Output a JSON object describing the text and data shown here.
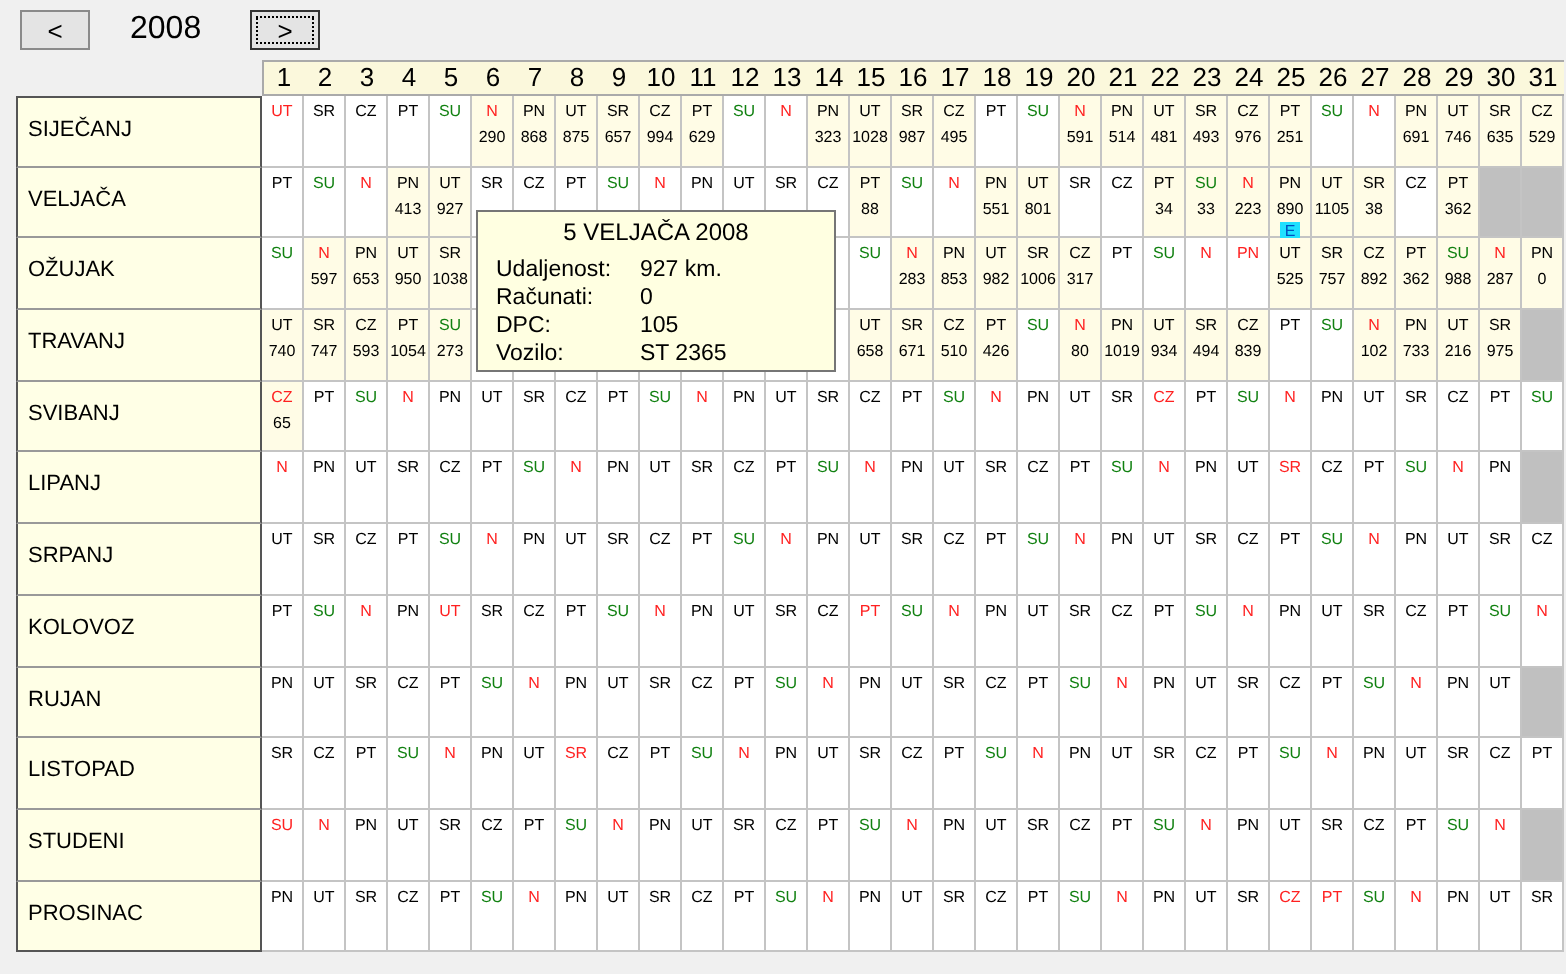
{
  "toolbar": {
    "prev_button": {
      "label": "<",
      "focused": false
    },
    "year": "2008",
    "next_button": {
      "label": ">",
      "focused": true
    }
  },
  "day_headers": [
    "1",
    "2",
    "3",
    "4",
    "5",
    "6",
    "7",
    "8",
    "9",
    "10",
    "11",
    "12",
    "13",
    "14",
    "15",
    "16",
    "17",
    "18",
    "19",
    "20",
    "21",
    "22",
    "23",
    "24",
    "25",
    "26",
    "27",
    "28",
    "29",
    "30",
    "31"
  ],
  "months": [
    {
      "name": "SIJEČANJ",
      "days": [
        {
          "day": "UT",
          "color": "#ff2020"
        },
        {
          "day": "SR"
        },
        {
          "day": "CZ"
        },
        {
          "day": "PT"
        },
        {
          "day": "SU",
          "color": "#108010"
        },
        {
          "day": "N",
          "color": "#ff2020",
          "km": "290"
        },
        {
          "day": "PN",
          "km": "868"
        },
        {
          "day": "UT",
          "km": "875"
        },
        {
          "day": "SR",
          "km": "657"
        },
        {
          "day": "CZ",
          "km": "994"
        },
        {
          "day": "PT",
          "km": "629"
        },
        {
          "day": "SU",
          "color": "#108010"
        },
        {
          "day": "N",
          "color": "#ff2020"
        },
        {
          "day": "PN",
          "km": "323"
        },
        {
          "day": "UT",
          "km": "1028"
        },
        {
          "day": "SR",
          "km": "987"
        },
        {
          "day": "CZ",
          "km": "495"
        },
        {
          "day": "PT"
        },
        {
          "day": "SU",
          "color": "#108010"
        },
        {
          "day": "N",
          "color": "#ff2020",
          "km": "591"
        },
        {
          "day": "PN",
          "km": "514"
        },
        {
          "day": "UT",
          "km": "481"
        },
        {
          "day": "SR",
          "km": "493"
        },
        {
          "day": "CZ",
          "km": "976"
        },
        {
          "day": "PT",
          "km": "251"
        },
        {
          "day": "SU",
          "color": "#108010"
        },
        {
          "day": "N",
          "color": "#ff2020"
        },
        {
          "day": "PN",
          "km": "691"
        },
        {
          "day": "UT",
          "km": "746"
        },
        {
          "day": "SR",
          "km": "635"
        },
        {
          "day": "CZ",
          "km": "529"
        }
      ]
    },
    {
      "name": "VELJAČA",
      "days": [
        {
          "day": "PT"
        },
        {
          "day": "SU",
          "color": "#108010"
        },
        {
          "day": "N",
          "color": "#ff2020"
        },
        {
          "day": "PN",
          "km": "413"
        },
        {
          "day": "UT",
          "km": "927"
        },
        {
          "day": "SR"
        },
        {
          "day": "CZ"
        },
        {
          "day": "PT"
        },
        {
          "day": "SU",
          "color": "#108010"
        },
        {
          "day": "N",
          "color": "#ff2020"
        },
        {
          "day": "PN"
        },
        {
          "day": "UT"
        },
        {
          "day": "SR"
        },
        {
          "day": "CZ"
        },
        {
          "day": "PT",
          "km": "88"
        },
        {
          "day": "SU",
          "color": "#108010"
        },
        {
          "day": "N",
          "color": "#ff2020"
        },
        {
          "day": "PN",
          "km": "551"
        },
        {
          "day": "UT",
          "km": "801"
        },
        {
          "day": "SR"
        },
        {
          "day": "CZ"
        },
        {
          "day": "PT",
          "km": "34"
        },
        {
          "day": "SU",
          "color": "#108010",
          "km": "33"
        },
        {
          "day": "N",
          "color": "#ff2020",
          "km": "223"
        },
        {
          "day": "PN",
          "km": "890",
          "marker": "E"
        },
        {
          "day": "UT",
          "km": "1105"
        },
        {
          "day": "SR",
          "km": "38"
        },
        {
          "day": "CZ"
        },
        {
          "day": "PT",
          "km": "362"
        },
        {
          "kind": "blank"
        },
        {
          "kind": "blank"
        }
      ]
    },
    {
      "name": "OŽUJAK",
      "days": [
        {
          "day": "SU",
          "color": "#108010"
        },
        {
          "day": "N",
          "color": "#ff2020",
          "km": "597"
        },
        {
          "day": "PN",
          "km": "653"
        },
        {
          "day": "UT",
          "km": "950"
        },
        {
          "day": "SR",
          "km": "1038"
        },
        {
          "kind": "partly_covered"
        },
        {
          "kind": "covered"
        },
        {
          "kind": "covered"
        },
        {
          "kind": "covered"
        },
        {
          "kind": "covered"
        },
        {
          "kind": "covered"
        },
        {
          "kind": "covered"
        },
        {
          "kind": "covered"
        },
        {
          "kind": "partly_covered"
        },
        {
          "day": "SU",
          "color": "#108010"
        },
        {
          "day": "N",
          "color": "#ff2020",
          "km": "283"
        },
        {
          "day": "PN",
          "km": "853"
        },
        {
          "day": "UT",
          "km": "982"
        },
        {
          "day": "SR",
          "km": "1006"
        },
        {
          "day": "CZ",
          "km": "317"
        },
        {
          "day": "PT"
        },
        {
          "day": "SU",
          "color": "#108010"
        },
        {
          "day": "N",
          "color": "#ff2020"
        },
        {
          "day": "PN",
          "color": "#ff2020"
        },
        {
          "day": "UT",
          "km": "525"
        },
        {
          "day": "SR",
          "km": "757"
        },
        {
          "day": "CZ",
          "km": "892"
        },
        {
          "day": "PT",
          "km": "362"
        },
        {
          "day": "SU",
          "color": "#108010",
          "km": "988"
        },
        {
          "day": "N",
          "color": "#ff2020",
          "km": "287"
        },
        {
          "day": "PN",
          "km": "0"
        }
      ]
    },
    {
      "name": "TRAVANJ",
      "days": [
        {
          "day": "UT",
          "km": "740"
        },
        {
          "day": "SR",
          "km": "747"
        },
        {
          "day": "CZ",
          "km": "593"
        },
        {
          "day": "PT",
          "km": "1054"
        },
        {
          "day": "SU",
          "color": "#108010",
          "km": "273"
        },
        {
          "kind": "partly_covered"
        },
        {
          "kind": "partly_covered"
        },
        {
          "kind": "partly_covered"
        },
        {
          "kind": "partly_covered"
        },
        {
          "kind": "partly_covered"
        },
        {
          "kind": "partly_covered"
        },
        {
          "kind": "partly_covered"
        },
        {
          "kind": "partly_covered"
        },
        {
          "kind": "partly_covered"
        },
        {
          "day": "UT",
          "km": "658"
        },
        {
          "day": "SR",
          "km": "671"
        },
        {
          "day": "CZ",
          "km": "510"
        },
        {
          "day": "PT",
          "km": "426"
        },
        {
          "day": "SU",
          "color": "#108010"
        },
        {
          "day": "N",
          "color": "#ff2020",
          "km": "80"
        },
        {
          "day": "PN",
          "km": "1019"
        },
        {
          "day": "UT",
          "km": "934"
        },
        {
          "day": "SR",
          "km": "494"
        },
        {
          "day": "CZ",
          "km": "839"
        },
        {
          "day": "PT"
        },
        {
          "day": "SU",
          "color": "#108010"
        },
        {
          "day": "N",
          "color": "#ff2020",
          "km": "102"
        },
        {
          "day": "PN",
          "km": "733"
        },
        {
          "day": "UT",
          "km": "216"
        },
        {
          "day": "SR",
          "km": "975"
        },
        {
          "kind": "blank"
        }
      ]
    },
    {
      "name": "SVIBANJ",
      "days": [
        {
          "day": "CZ",
          "color": "#ff2020",
          "km": "65"
        },
        {
          "day": "PT"
        },
        {
          "day": "SU",
          "color": "#108010"
        },
        {
          "day": "N",
          "color": "#ff2020"
        },
        {
          "day": "PN"
        },
        {
          "day": "UT"
        },
        {
          "day": "SR"
        },
        {
          "day": "CZ"
        },
        {
          "day": "PT"
        },
        {
          "day": "SU",
          "color": "#108010"
        },
        {
          "day": "N",
          "color": "#ff2020"
        },
        {
          "day": "PN"
        },
        {
          "day": "UT"
        },
        {
          "day": "SR"
        },
        {
          "day": "CZ"
        },
        {
          "day": "PT"
        },
        {
          "day": "SU",
          "color": "#108010"
        },
        {
          "day": "N",
          "color": "#ff2020"
        },
        {
          "day": "PN"
        },
        {
          "day": "UT"
        },
        {
          "day": "SR"
        },
        {
          "day": "CZ",
          "color": "#ff2020"
        },
        {
          "day": "PT"
        },
        {
          "day": "SU",
          "color": "#108010"
        },
        {
          "day": "N",
          "color": "#ff2020"
        },
        {
          "day": "PN"
        },
        {
          "day": "UT"
        },
        {
          "day": "SR"
        },
        {
          "day": "CZ"
        },
        {
          "day": "PT"
        },
        {
          "day": "SU",
          "color": "#108010"
        }
      ]
    },
    {
      "name": "LIPANJ",
      "days": [
        {
          "day": "N",
          "color": "#ff2020"
        },
        {
          "day": "PN"
        },
        {
          "day": "UT"
        },
        {
          "day": "SR"
        },
        {
          "day": "CZ"
        },
        {
          "day": "PT"
        },
        {
          "day": "SU",
          "color": "#108010"
        },
        {
          "day": "N",
          "color": "#ff2020"
        },
        {
          "day": "PN"
        },
        {
          "day": "UT"
        },
        {
          "day": "SR"
        },
        {
          "day": "CZ"
        },
        {
          "day": "PT"
        },
        {
          "day": "SU",
          "color": "#108010"
        },
        {
          "day": "N",
          "color": "#ff2020"
        },
        {
          "day": "PN"
        },
        {
          "day": "UT"
        },
        {
          "day": "SR"
        },
        {
          "day": "CZ"
        },
        {
          "day": "PT"
        },
        {
          "day": "SU",
          "color": "#108010"
        },
        {
          "day": "N",
          "color": "#ff2020"
        },
        {
          "day": "PN"
        },
        {
          "day": "UT"
        },
        {
          "day": "SR",
          "color": "#ff2020"
        },
        {
          "day": "CZ"
        },
        {
          "day": "PT"
        },
        {
          "day": "SU",
          "color": "#108010"
        },
        {
          "day": "N",
          "color": "#ff2020"
        },
        {
          "day": "PN"
        },
        {
          "kind": "blank"
        }
      ]
    },
    {
      "name": "SRPANJ",
      "days": [
        {
          "day": "UT"
        },
        {
          "day": "SR"
        },
        {
          "day": "CZ"
        },
        {
          "day": "PT"
        },
        {
          "day": "SU",
          "color": "#108010"
        },
        {
          "day": "N",
          "color": "#ff2020"
        },
        {
          "day": "PN"
        },
        {
          "day": "UT"
        },
        {
          "day": "SR"
        },
        {
          "day": "CZ"
        },
        {
          "day": "PT"
        },
        {
          "day": "SU",
          "color": "#108010"
        },
        {
          "day": "N",
          "color": "#ff2020"
        },
        {
          "day": "PN"
        },
        {
          "day": "UT"
        },
        {
          "day": "SR"
        },
        {
          "day": "CZ"
        },
        {
          "day": "PT"
        },
        {
          "day": "SU",
          "color": "#108010"
        },
        {
          "day": "N",
          "color": "#ff2020"
        },
        {
          "day": "PN"
        },
        {
          "day": "UT"
        },
        {
          "day": "SR"
        },
        {
          "day": "CZ"
        },
        {
          "day": "PT"
        },
        {
          "day": "SU",
          "color": "#108010"
        },
        {
          "day": "N",
          "color": "#ff2020"
        },
        {
          "day": "PN"
        },
        {
          "day": "UT"
        },
        {
          "day": "SR"
        },
        {
          "day": "CZ"
        }
      ]
    },
    {
      "name": "KOLOVOZ",
      "days": [
        {
          "day": "PT"
        },
        {
          "day": "SU",
          "color": "#108010"
        },
        {
          "day": "N",
          "color": "#ff2020"
        },
        {
          "day": "PN"
        },
        {
          "day": "UT",
          "color": "#ff2020"
        },
        {
          "day": "SR"
        },
        {
          "day": "CZ"
        },
        {
          "day": "PT"
        },
        {
          "day": "SU",
          "color": "#108010"
        },
        {
          "day": "N",
          "color": "#ff2020"
        },
        {
          "day": "PN"
        },
        {
          "day": "UT"
        },
        {
          "day": "SR"
        },
        {
          "day": "CZ"
        },
        {
          "day": "PT",
          "color": "#ff2020"
        },
        {
          "day": "SU",
          "color": "#108010"
        },
        {
          "day": "N",
          "color": "#ff2020"
        },
        {
          "day": "PN"
        },
        {
          "day": "UT"
        },
        {
          "day": "SR"
        },
        {
          "day": "CZ"
        },
        {
          "day": "PT"
        },
        {
          "day": "SU",
          "color": "#108010"
        },
        {
          "day": "N",
          "color": "#ff2020"
        },
        {
          "day": "PN"
        },
        {
          "day": "UT"
        },
        {
          "day": "SR"
        },
        {
          "day": "CZ"
        },
        {
          "day": "PT"
        },
        {
          "day": "SU",
          "color": "#108010"
        },
        {
          "day": "N",
          "color": "#ff2020"
        }
      ]
    },
    {
      "name": "RUJAN",
      "days": [
        {
          "day": "PN"
        },
        {
          "day": "UT"
        },
        {
          "day": "SR"
        },
        {
          "day": "CZ"
        },
        {
          "day": "PT"
        },
        {
          "day": "SU",
          "color": "#108010"
        },
        {
          "day": "N",
          "color": "#ff2020"
        },
        {
          "day": "PN"
        },
        {
          "day": "UT"
        },
        {
          "day": "SR"
        },
        {
          "day": "CZ"
        },
        {
          "day": "PT"
        },
        {
          "day": "SU",
          "color": "#108010"
        },
        {
          "day": "N",
          "color": "#ff2020"
        },
        {
          "day": "PN"
        },
        {
          "day": "UT"
        },
        {
          "day": "SR"
        },
        {
          "day": "CZ"
        },
        {
          "day": "PT"
        },
        {
          "day": "SU",
          "color": "#108010"
        },
        {
          "day": "N",
          "color": "#ff2020"
        },
        {
          "day": "PN"
        },
        {
          "day": "UT"
        },
        {
          "day": "SR"
        },
        {
          "day": "CZ"
        },
        {
          "day": "PT"
        },
        {
          "day": "SU",
          "color": "#108010"
        },
        {
          "day": "N",
          "color": "#ff2020"
        },
        {
          "day": "PN"
        },
        {
          "day": "UT"
        },
        {
          "kind": "blank"
        }
      ]
    },
    {
      "name": "LISTOPAD",
      "days": [
        {
          "day": "SR"
        },
        {
          "day": "CZ"
        },
        {
          "day": "PT"
        },
        {
          "day": "SU",
          "color": "#108010"
        },
        {
          "day": "N",
          "color": "#ff2020"
        },
        {
          "day": "PN"
        },
        {
          "day": "UT"
        },
        {
          "day": "SR",
          "color": "#ff2020"
        },
        {
          "day": "CZ"
        },
        {
          "day": "PT"
        },
        {
          "day": "SU",
          "color": "#108010"
        },
        {
          "day": "N",
          "color": "#ff2020"
        },
        {
          "day": "PN"
        },
        {
          "day": "UT"
        },
        {
          "day": "SR"
        },
        {
          "day": "CZ"
        },
        {
          "day": "PT"
        },
        {
          "day": "SU",
          "color": "#108010"
        },
        {
          "day": "N",
          "color": "#ff2020"
        },
        {
          "day": "PN"
        },
        {
          "day": "UT"
        },
        {
          "day": "SR"
        },
        {
          "day": "CZ"
        },
        {
          "day": "PT"
        },
        {
          "day": "SU",
          "color": "#108010"
        },
        {
          "day": "N",
          "color": "#ff2020"
        },
        {
          "day": "PN"
        },
        {
          "day": "UT"
        },
        {
          "day": "SR"
        },
        {
          "day": "CZ"
        },
        {
          "day": "PT"
        }
      ]
    },
    {
      "name": "STUDENI",
      "days": [
        {
          "day": "SU",
          "color": "#ff2020"
        },
        {
          "day": "N",
          "color": "#ff2020"
        },
        {
          "day": "PN"
        },
        {
          "day": "UT"
        },
        {
          "day": "SR"
        },
        {
          "day": "CZ"
        },
        {
          "day": "PT"
        },
        {
          "day": "SU",
          "color": "#108010"
        },
        {
          "day": "N",
          "color": "#ff2020"
        },
        {
          "day": "PN"
        },
        {
          "day": "UT"
        },
        {
          "day": "SR"
        },
        {
          "day": "CZ"
        },
        {
          "day": "PT"
        },
        {
          "day": "SU",
          "color": "#108010"
        },
        {
          "day": "N",
          "color": "#ff2020"
        },
        {
          "day": "PN"
        },
        {
          "day": "UT"
        },
        {
          "day": "SR"
        },
        {
          "day": "CZ"
        },
        {
          "day": "PT"
        },
        {
          "day": "SU",
          "color": "#108010"
        },
        {
          "day": "N",
          "color": "#ff2020"
        },
        {
          "day": "PN"
        },
        {
          "day": "UT"
        },
        {
          "day": "SR"
        },
        {
          "day": "CZ"
        },
        {
          "day": "PT"
        },
        {
          "day": "SU",
          "color": "#108010"
        },
        {
          "day": "N",
          "color": "#ff2020"
        },
        {
          "kind": "blank"
        }
      ]
    },
    {
      "name": "PROSINAC",
      "days": [
        {
          "day": "PN"
        },
        {
          "day": "UT"
        },
        {
          "day": "SR"
        },
        {
          "day": "CZ"
        },
        {
          "day": "PT"
        },
        {
          "day": "SU",
          "color": "#108010"
        },
        {
          "day": "N",
          "color": "#ff2020"
        },
        {
          "day": "PN"
        },
        {
          "day": "UT"
        },
        {
          "day": "SR"
        },
        {
          "day": "CZ"
        },
        {
          "day": "PT"
        },
        {
          "day": "SU",
          "color": "#108010"
        },
        {
          "day": "N",
          "color": "#ff2020"
        },
        {
          "day": "PN"
        },
        {
          "day": "UT"
        },
        {
          "day": "SR"
        },
        {
          "day": "CZ"
        },
        {
          "day": "PT"
        },
        {
          "day": "SU",
          "color": "#108010"
        },
        {
          "day": "N",
          "color": "#ff2020"
        },
        {
          "day": "PN"
        },
        {
          "day": "UT"
        },
        {
          "day": "SR"
        },
        {
          "day": "CZ",
          "color": "#ff2020"
        },
        {
          "day": "PT",
          "color": "#ff2020"
        },
        {
          "day": "SU",
          "color": "#108010"
        },
        {
          "day": "N",
          "color": "#ff2020"
        },
        {
          "day": "PN"
        },
        {
          "day": "UT"
        },
        {
          "day": "SR"
        }
      ]
    }
  ],
  "tooltip": {
    "title": "5 VELJAČA 2008",
    "rows": [
      {
        "label": "Udaljenost:",
        "value": "927 km."
      },
      {
        "label": "Računati:",
        "value": "0"
      },
      {
        "label": "DPC:",
        "value": "105"
      },
      {
        "label": "Vozilo:",
        "value": "ST 2365"
      }
    ]
  }
}
